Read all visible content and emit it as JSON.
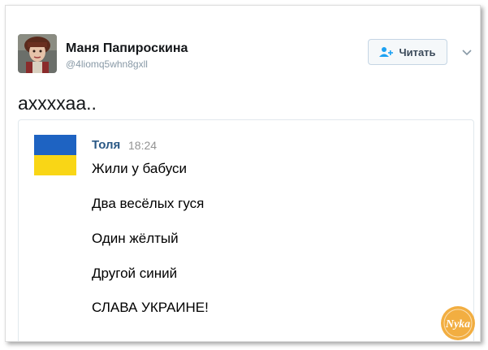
{
  "author": {
    "name": "Маня Папироскина",
    "handle": "@4liomq5whn8gxll"
  },
  "follow": {
    "label": "Читать",
    "icon": "add-user-icon"
  },
  "menu_icon": "chevron-down-icon",
  "tweet": {
    "text": "аххххаа.."
  },
  "quote": {
    "name": "Толя",
    "time": "18:24",
    "lines": [
      "Жили у бабуси",
      "Два весёлых гуся",
      "Один жёлтый",
      "Другой синий",
      "СЛАВА УКРАИНЕ!"
    ],
    "flag_colors": [
      "#1e63c2",
      "#f9d616"
    ]
  },
  "watermark": {
    "text": "Nyka"
  },
  "colors": {
    "name_link": "#2a5885",
    "handle": "#8899a6",
    "button_border": "#c5d5e4"
  }
}
